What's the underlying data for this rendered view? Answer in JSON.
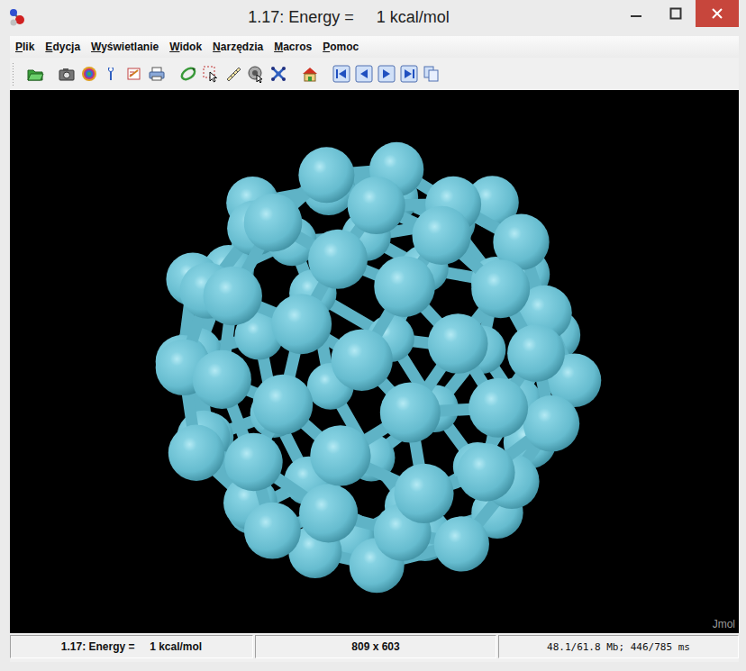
{
  "window": {
    "title": "1.17: Energy =     1 kcal/mol"
  },
  "menu": [
    {
      "label": "Plik"
    },
    {
      "label": "Edycja"
    },
    {
      "label": "Wyświetlanie"
    },
    {
      "label": "Widok"
    },
    {
      "label": "Narzędzia"
    },
    {
      "label": "Macros"
    },
    {
      "label": "Pomoc"
    }
  ],
  "canvas": {
    "watermark": "Jmol"
  },
  "status_bar": [
    {
      "text": "1.17: Energy =     1 kcal/mol",
      "kind": "label"
    },
    {
      "text": "809 x 603",
      "kind": "label"
    },
    {
      "text": "48.1/61.8 Mb; 446/785 ms",
      "kind": "mono"
    }
  ]
}
